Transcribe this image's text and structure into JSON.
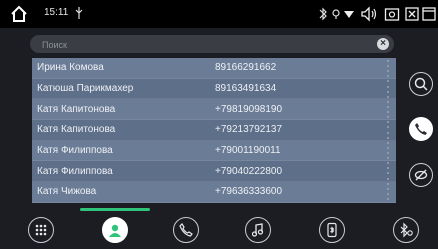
{
  "status_bar": {
    "time": "15:11",
    "icons": [
      "home-icon",
      "usb-icon",
      "bluetooth-icon",
      "location-icon",
      "wifi-icon",
      "volume-icon",
      "screenshot-icon",
      "close-box-icon",
      "window-icon",
      "back-icon"
    ]
  },
  "search": {
    "placeholder": "Поиск",
    "value": ""
  },
  "contacts": [
    {
      "name": "Ирина Комова",
      "phone": "89166291662"
    },
    {
      "name": "Катюша Парикмахер",
      "phone": "89163491634"
    },
    {
      "name": "Катя Капитонова",
      "phone": "+79819098190"
    },
    {
      "name": "Катя Капитонова",
      "phone": "+79213792137"
    },
    {
      "name": "Катя Филиппова",
      "phone": "+79001190011"
    },
    {
      "name": "Катя Филиппова",
      "phone": "+79040222800"
    },
    {
      "name": "Катя Чижова",
      "phone": "+79636333600"
    }
  ],
  "side_buttons": [
    "search-icon",
    "phone-icon",
    "link-off-icon"
  ],
  "dock": [
    "keypad-icon",
    "contacts-icon",
    "call-log-icon",
    "music-icon",
    "bluetooth-device-icon",
    "bluetooth-settings-icon"
  ],
  "colors": {
    "accent": "#2fc47a",
    "row": "#6b7c96",
    "background": "#1c1d22"
  }
}
